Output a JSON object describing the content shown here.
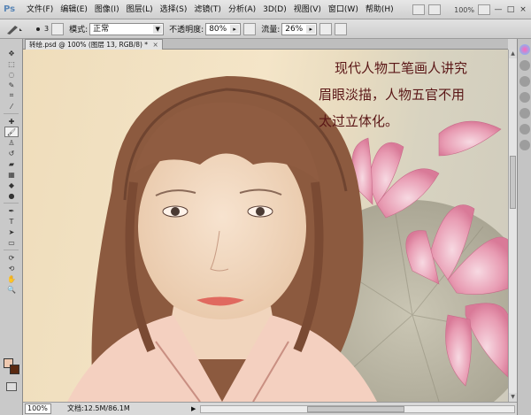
{
  "app": {
    "logo": "Ps"
  },
  "menu": [
    "文件(F)",
    "编辑(E)",
    "图像(I)",
    "图层(L)",
    "选择(S)",
    "滤镜(T)",
    "分析(A)",
    "3D(D)",
    "视图(V)",
    "窗口(W)",
    "帮助(H)"
  ],
  "menubar_right": {
    "zoom": "100%",
    "min": "—",
    "max": "□",
    "close": "×"
  },
  "options": {
    "brush_size": "3",
    "mode_label": "模式:",
    "mode_value": "正常",
    "opacity_label": "不透明度:",
    "opacity_value": "80%",
    "flow_label": "流量:",
    "flow_value": "26%"
  },
  "document": {
    "tab_title": "转绘.psd @ 100% (图层 13, RGB/8) *",
    "close": "×"
  },
  "canvas_text": {
    "line1": "现代人物工笔画人讲究",
    "line2": "眉眼淡描，人物五官不用",
    "line3": "太过立体化。"
  },
  "colors": {
    "foreground": "#efc9b0",
    "background": "#5a2a12"
  },
  "status": {
    "zoom": "100%",
    "doc_size": "文档:12.5M/86.1M",
    "arrow": "▶"
  }
}
